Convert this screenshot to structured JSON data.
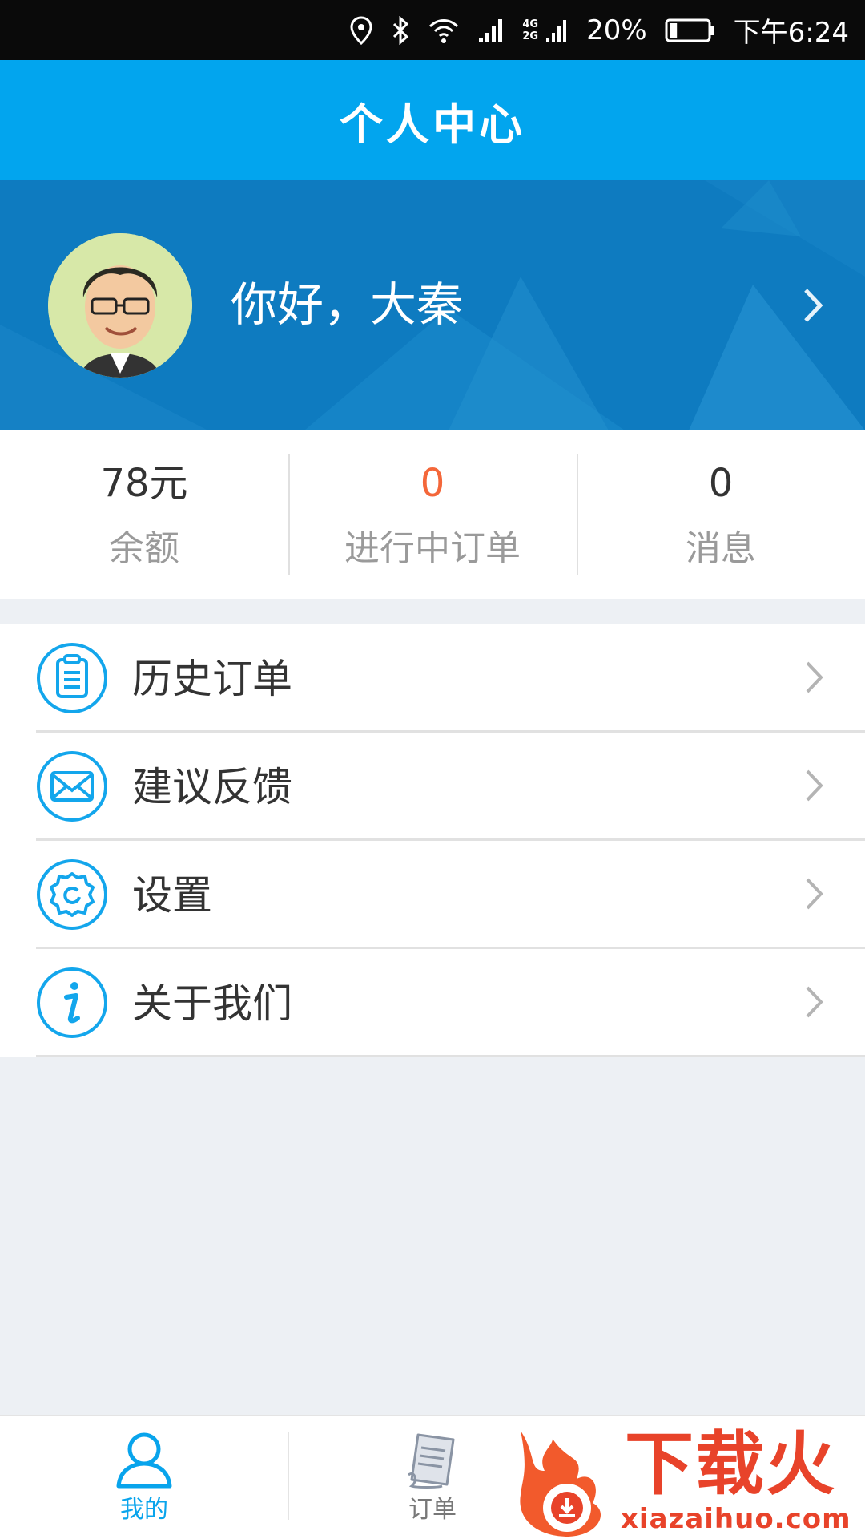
{
  "status_bar": {
    "net_top": "4G",
    "net_bottom": "2G",
    "battery": "20%",
    "time": "下午6:24",
    "icons": [
      "location-icon",
      "bluetooth-icon",
      "wifi-icon",
      "signal-icon",
      "dual-signal-icon",
      "battery-icon"
    ],
    "battery_level": 0.2
  },
  "header": {
    "title": "个人中心"
  },
  "profile": {
    "greeting": "你好，大秦",
    "avatar": "avatar-icon",
    "chevron": "chevron-right-icon"
  },
  "stats": [
    {
      "value": "78元",
      "label": "余额"
    },
    {
      "value": "0",
      "label": "进行中订单",
      "value_color": "#f4673a"
    },
    {
      "value": "0",
      "label": "消息"
    }
  ],
  "menu": [
    {
      "label": "历史订单",
      "icon": "clipboard-icon"
    },
    {
      "label": "建议反馈",
      "icon": "mail-icon"
    },
    {
      "label": "设置",
      "icon": "settings-icon"
    },
    {
      "label": "关于我们",
      "icon": "info-icon"
    }
  ],
  "bottom_nav": [
    {
      "label": "我的",
      "icon": "person-icon",
      "active": true
    },
    {
      "label": "订单",
      "icon": "receipt-icon",
      "active": false
    }
  ],
  "watermark": {
    "text": "下载火",
    "url": "xiazaihuo.com"
  },
  "colors": {
    "title_bar": "#02a5ee",
    "profile_bg": "#0e7bc0",
    "accent": "#08a4ec",
    "orange": "#f4673a",
    "background": "#edf0f4"
  }
}
